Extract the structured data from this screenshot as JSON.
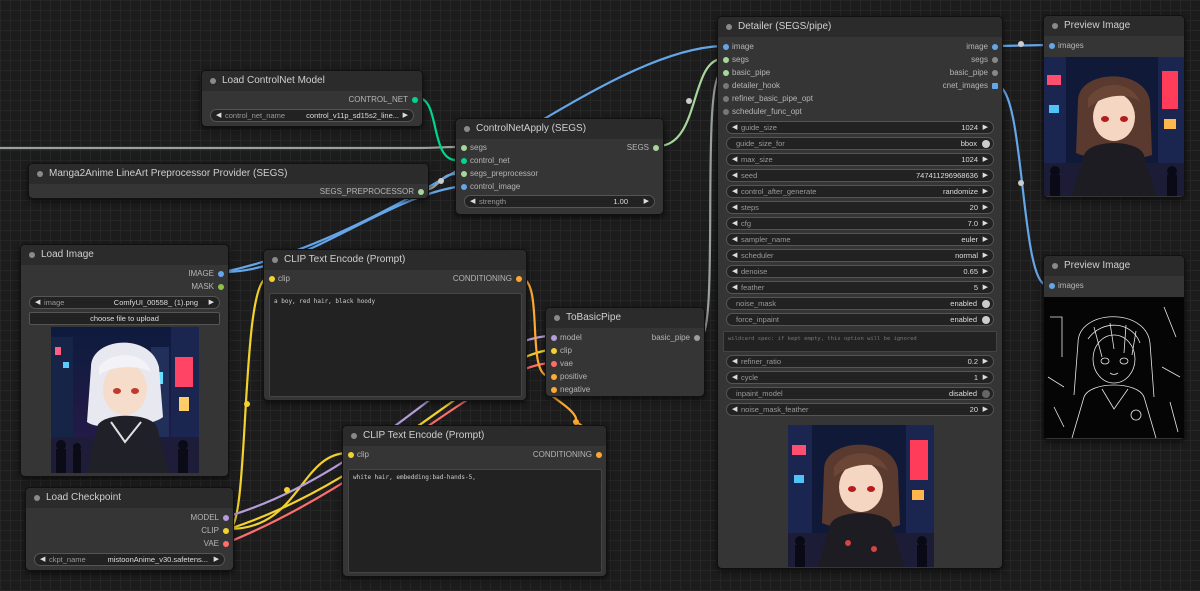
{
  "colors": {
    "canvas": "#1c1c1c",
    "node_bg": "#353535",
    "title_bg": "#2b2b2b",
    "link_image": "#64a6e8",
    "link_clip": "#f2d230",
    "link_model": "#b39ddb",
    "link_vae": "#ff6e6e",
    "link_controlnet": "#00d78d",
    "link_conditioning": "#ffa931",
    "link_segs": "#a8d69a",
    "link_gray": "#9aa09a"
  },
  "nodes": {
    "load_controlnet": {
      "title": "Load ControlNet Model",
      "output": "CONTROL_NET",
      "widget_label": "control_net_name",
      "widget_value": "control_v11p_sd15s2_line..."
    },
    "manga_preprocessor": {
      "title": "Manga2Anime LineArt Preprocessor Provider (SEGS)",
      "output": "SEGS_PREPROCESSOR"
    },
    "controlnet_apply": {
      "title": "ControlNetApply (SEGS)",
      "inputs": [
        "segs",
        "control_net",
        "segs_preprocessor",
        "control_image"
      ],
      "output": "SEGS",
      "widget_label": "strength",
      "widget_value": "1.00"
    },
    "load_image": {
      "title": "Load Image",
      "outputs": [
        "IMAGE",
        "MASK"
      ],
      "widget_label": "image",
      "widget_value": "ComfyUI_00558_ (1).png",
      "button": "choose file to upload"
    },
    "clip_text_1": {
      "title": "CLIP Text Encode (Prompt)",
      "input": "clip",
      "output": "CONDITIONING",
      "text": "a boy, red hair, black hoody"
    },
    "clip_text_2": {
      "title": "CLIP Text Encode (Prompt)",
      "input": "clip",
      "output": "CONDITIONING",
      "text": "white hair, embedding:bad-hands-5,"
    },
    "load_checkpoint": {
      "title": "Load Checkpoint",
      "outputs": [
        "MODEL",
        "CLIP",
        "VAE"
      ],
      "widget_label": "ckpt_name",
      "widget_value": "mistoonAnime_v30.safetens..."
    },
    "to_basic_pipe": {
      "title": "ToBasicPipe",
      "inputs": [
        "model",
        "clip",
        "vae",
        "positive",
        "negative"
      ],
      "output": "basic_pipe"
    },
    "detailer": {
      "title": "Detailer (SEGS/pipe)",
      "inputs": [
        "image",
        "segs",
        "basic_pipe",
        "detailer_hook",
        "refiner_basic_pipe_opt",
        "scheduler_func_opt"
      ],
      "outputs": [
        "image",
        "segs",
        "basic_pipe",
        "cnet_images"
      ],
      "widgets_a": [
        {
          "label": "guide_size",
          "value": "1024",
          "kind": "num"
        },
        {
          "label": "guide_size_for",
          "value": "bbox",
          "kind": "toggle",
          "on": true
        },
        {
          "label": "max_size",
          "value": "1024",
          "kind": "num"
        },
        {
          "label": "seed",
          "value": "747411296968636",
          "kind": "num"
        },
        {
          "label": "control_after_generate",
          "value": "randomize",
          "kind": "num"
        },
        {
          "label": "steps",
          "value": "20",
          "kind": "num"
        },
        {
          "label": "cfg",
          "value": "7.0",
          "kind": "num"
        },
        {
          "label": "sampler_name",
          "value": "euler",
          "kind": "num"
        },
        {
          "label": "scheduler",
          "value": "normal",
          "kind": "num"
        },
        {
          "label": "denoise",
          "value": "0.65",
          "kind": "num"
        },
        {
          "label": "feather",
          "value": "5",
          "kind": "num"
        },
        {
          "label": "noise_mask",
          "value": "enabled",
          "kind": "toggle",
          "on": true
        },
        {
          "label": "force_inpaint",
          "value": "enabled",
          "kind": "toggle",
          "on": true
        }
      ],
      "wildcard_placeholder": "wildcard spec: if kept empty, this option will be ignored",
      "widgets_b": [
        {
          "label": "refiner_ratio",
          "value": "0.2",
          "kind": "num"
        },
        {
          "label": "cycle",
          "value": "1",
          "kind": "num"
        },
        {
          "label": "inpaint_model",
          "value": "disabled",
          "kind": "toggle",
          "on": false
        },
        {
          "label": "noise_mask_feather",
          "value": "20",
          "kind": "num"
        }
      ]
    },
    "preview_1": {
      "title": "Preview Image",
      "input": "images"
    },
    "preview_2": {
      "title": "Preview Image",
      "input": "images"
    }
  }
}
